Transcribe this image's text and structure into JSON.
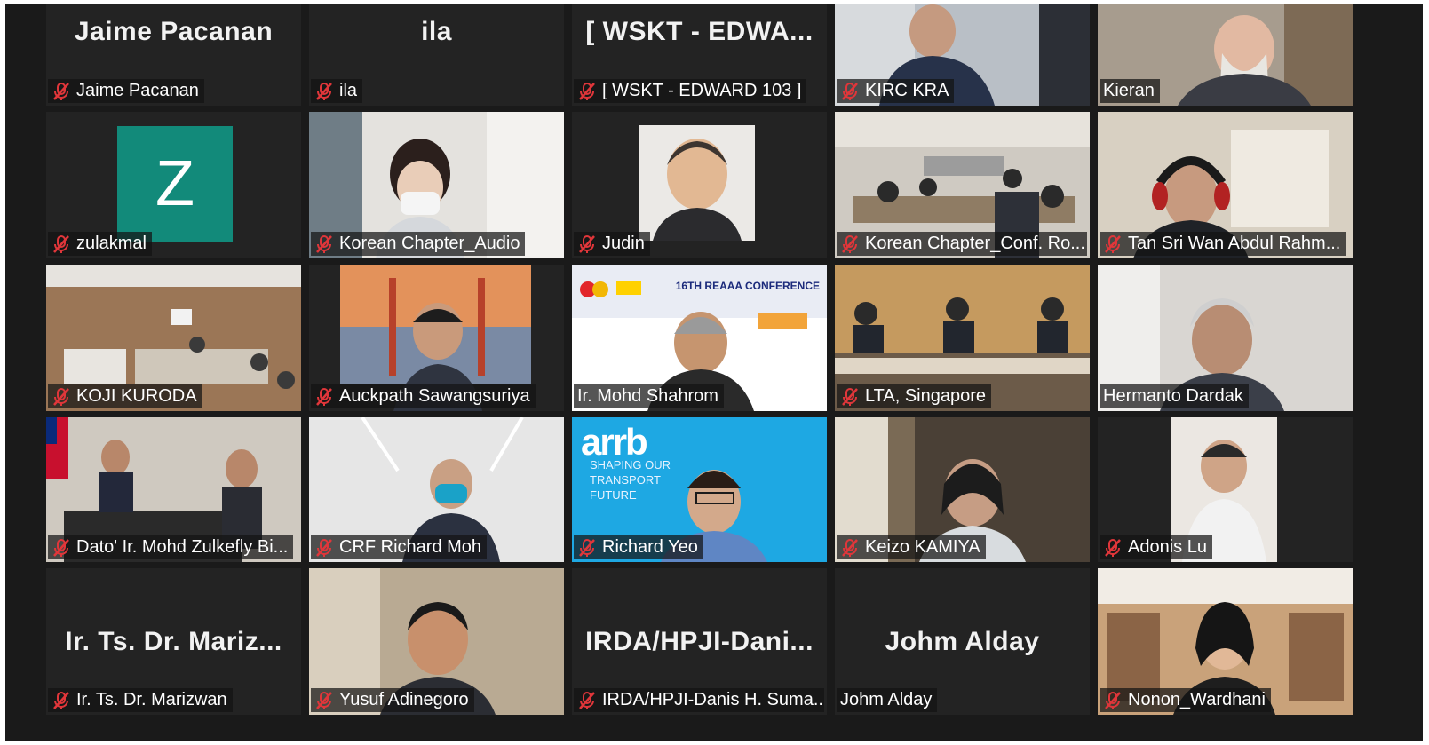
{
  "meeting": {
    "participants": [
      {
        "tag": "Jaime Pacanan",
        "big_name": "Jaime Pacanan",
        "muted": true,
        "video": false
      },
      {
        "tag": "ila",
        "big_name": "ila",
        "muted": true,
        "video": false
      },
      {
        "tag": "[ WSKT - EDWARD 103 ]",
        "big_name": "[ WSKT - EDWA...",
        "muted": true,
        "video": false
      },
      {
        "tag": "KIRC KRA",
        "muted": true,
        "video": true
      },
      {
        "tag": "Kieran",
        "muted": false,
        "video": true
      },
      {
        "tag": "zulakmal",
        "avatar_letter": "Z",
        "muted": true,
        "video": false
      },
      {
        "tag": "Korean Chapter_Audio",
        "muted": true,
        "video": true
      },
      {
        "tag": "Judin",
        "muted": true,
        "video": true
      },
      {
        "tag": "Korean Chapter_Conf. Ro...",
        "muted": true,
        "video": true
      },
      {
        "tag": "Tan Sri Wan Abdul Rahm...",
        "muted": true,
        "video": true
      },
      {
        "tag": "KOJI KURODA",
        "muted": true,
        "video": true
      },
      {
        "tag": "Auckpath Sawangsuriya",
        "muted": true,
        "video": true
      },
      {
        "tag": "Ir. Mohd Shahrom",
        "muted": false,
        "video": true,
        "active_speaker": true,
        "background_text": "16TH REAAA CONFERENCE"
      },
      {
        "tag": "LTA, Singapore",
        "muted": true,
        "video": true
      },
      {
        "tag": "Hermanto Dardak",
        "muted": false,
        "video": true
      },
      {
        "tag": "Dato' Ir. Mohd Zulkefly Bi...",
        "muted": true,
        "video": true
      },
      {
        "tag": "CRF Richard Moh",
        "muted": true,
        "video": true
      },
      {
        "tag": "Richard Yeo",
        "muted": true,
        "video": true,
        "background_logo": "arrb",
        "background_text": "SHAPING OUR TRANSPORT FUTURE"
      },
      {
        "tag": "Keizo KAMIYA",
        "muted": true,
        "video": true
      },
      {
        "tag": "Adonis Lu",
        "muted": true,
        "video": true
      },
      {
        "tag": "Ir. Ts. Dr. Marizwan",
        "big_name": "Ir. Ts. Dr. Mariz...",
        "muted": true,
        "video": false
      },
      {
        "tag": "Yusuf Adinegoro",
        "muted": true,
        "video": true
      },
      {
        "tag": "IRDA/HPJI-Danis H. Suma...",
        "big_name": "IRDA/HPJI-Dani...",
        "muted": true,
        "video": false
      },
      {
        "tag": "Johm Alday",
        "big_name": "Johm Alday",
        "muted": false,
        "video": false
      },
      {
        "tag": "Nonon_Wardhani",
        "muted": true,
        "video": true
      }
    ]
  },
  "colors": {
    "background": "#1a1a1a",
    "tile": "#232323",
    "active_speaker_border": "#e3ef6a",
    "mute_icon": "#e0363a",
    "avatar": "#128a7a"
  }
}
